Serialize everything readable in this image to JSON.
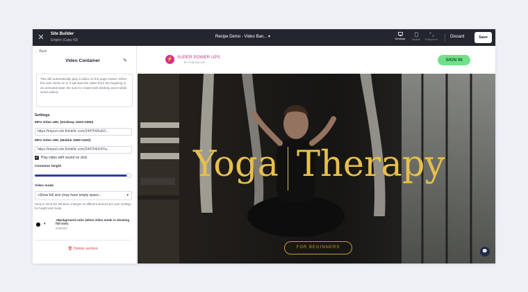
{
  "topbar": {
    "close_icon": "close-icon",
    "title": "Site Builder",
    "subtitle": "Empire (Copy 42)",
    "page_select": "Recipe Demo - Video Ban...",
    "views": [
      {
        "label": "Desktop",
        "icon": "desktop-icon",
        "active": true
      },
      {
        "label": "Mobile",
        "icon": "mobile-icon",
        "active": false
      },
      {
        "label": "Fullscreen",
        "icon": "fullscreen-icon",
        "active": false
      }
    ],
    "discard": "Discard",
    "save": "Save"
  },
  "panel": {
    "back": "Back",
    "title": "Video Container",
    "info": "This will automatically play a video on the page muted. When the user clicks on it, it will start the video from the begining in an unmuted state. Be sure to create both desktop and mobile sized videos.",
    "settings_heading": "Settings",
    "desktop_label": "MP4 Video URL (Desktop 1920×1080)",
    "desktop_value": "https://import.cdn.thinkific.com/244754/hzE0...",
    "mobile_label": "MP4 Video URL (Mobile 1080×1920)",
    "mobile_value": "https://import.cdn.thinkific.com/244754/U4Yw...",
    "checkbox_label": "Play video with sound on click",
    "checkbox_checked": true,
    "container_height_label": "Container height",
    "container_height_fraction": 1.0,
    "video_mode_label": "Video mode",
    "video_mode_value": "+Show full size (may have empty space...",
    "hint": "Keep in mind the behavior changes on different devices per your settings for height and mode.",
    "bg_label": "+Background color (when video mode is showing full size)",
    "bg_hex": "#000000",
    "bg_color": "#000000",
    "delete": "Delete section"
  },
  "preview": {
    "logo_text": "SUPER POWER UPS",
    "logo_sub": "BY ROB GALVIN",
    "signin": "SIGN IN",
    "hero_left": "Yoga",
    "hero_right": "Therapy",
    "cta": "FOR BEGINNERS"
  },
  "colors": {
    "topbar": "#23262f",
    "accent_blue": "#2d3ca8",
    "signin_green": "#72e08a",
    "hero_gold": "#e6bf4d",
    "brand_pink": "#d62f89",
    "delete_red": "#d64545"
  }
}
